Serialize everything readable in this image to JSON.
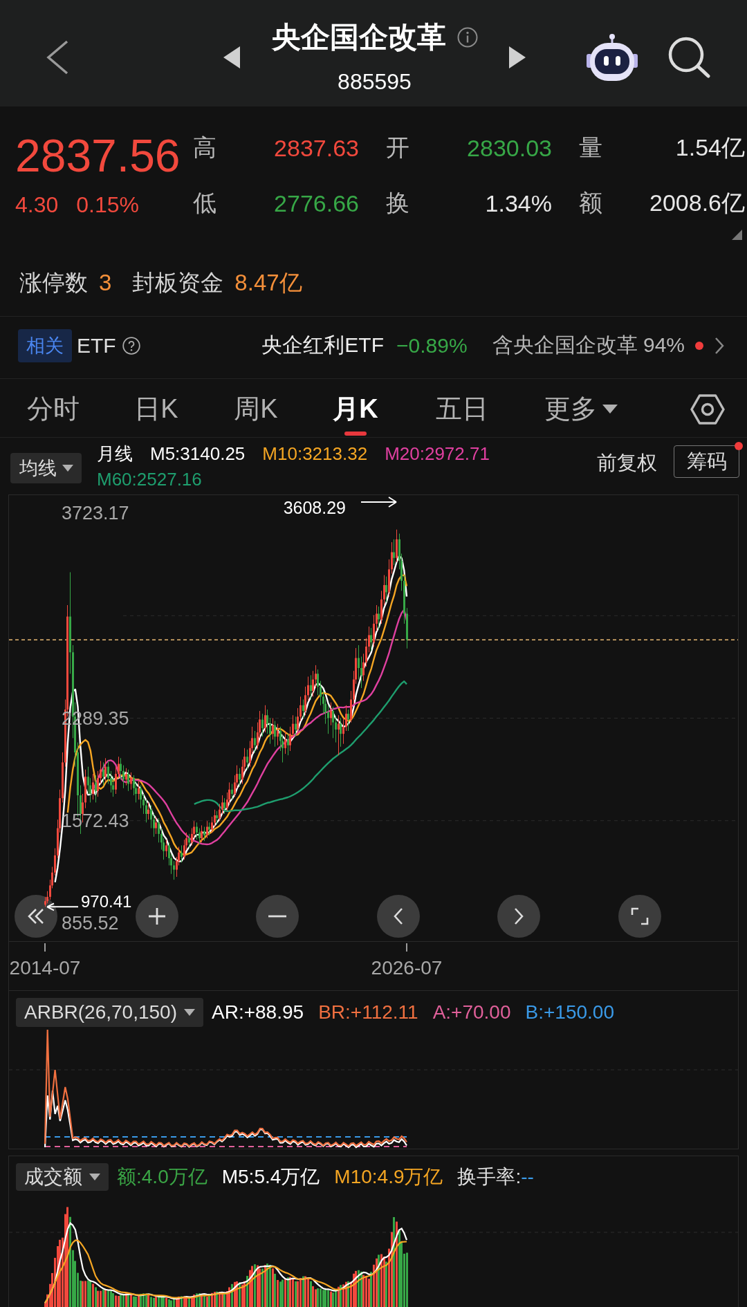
{
  "header": {
    "title": "央企国企改革",
    "code": "885595"
  },
  "quote": {
    "price": "2837.56",
    "rising": true,
    "change": "4.30",
    "change_percent": "0.15%",
    "stats": [
      {
        "label": "高",
        "value": "2837.63",
        "color": "#f2493d"
      },
      {
        "label": "开",
        "value": "2830.03",
        "color": "#37a847"
      },
      {
        "label": "量",
        "value": "1.54亿",
        "color": "#e8e8e8"
      },
      {
        "label": "低",
        "value": "2776.66",
        "color": "#37a847"
      },
      {
        "label": "换",
        "value": "1.34%",
        "color": "#e8e8e8"
      },
      {
        "label": "额",
        "value": "2008.6亿",
        "color": "#e8e8e8"
      }
    ]
  },
  "limit_up": {
    "count_label": "涨停数",
    "count": "3",
    "funds_label": "封板资金",
    "funds": "8.47亿"
  },
  "related_etf": {
    "badge": "相关",
    "label": "ETF",
    "name": "央企红利ETF",
    "change": "−0.89%",
    "rising": false,
    "holding": "含央企国企改革 94%",
    "dot": true
  },
  "tabs": [
    {
      "label": "分时",
      "selected": false,
      "kind": "plain"
    },
    {
      "label": "日K",
      "selected": false,
      "kind": "plain"
    },
    {
      "label": "周K",
      "selected": false,
      "kind": "plain"
    },
    {
      "label": "月K",
      "selected": true,
      "kind": "plain"
    },
    {
      "label": "五日",
      "selected": false,
      "kind": "plain"
    },
    {
      "label": "更多",
      "selected": false,
      "kind": "menu"
    }
  ],
  "indicator_bar": {
    "dropdown": "均线",
    "period": "月线",
    "adjust": "前复权",
    "chips": {
      "label": "筹码",
      "dot": true
    }
  },
  "price_chart": {
    "chart_data": {
      "type": "candlestick",
      "categories": [
        "2014-07",
        null,
        null,
        null,
        null,
        null,
        null,
        null,
        null,
        null,
        null,
        null,
        null,
        null,
        null,
        null,
        null,
        null,
        null,
        null,
        null,
        null,
        null,
        null,
        null,
        null,
        null,
        null,
        null,
        null,
        null,
        null,
        null,
        null,
        null,
        null,
        null,
        null,
        null,
        null,
        null,
        null,
        null,
        null,
        null,
        null,
        null,
        null,
        null,
        null,
        null,
        null,
        null,
        null,
        null,
        null,
        null,
        null,
        null,
        null,
        null,
        null,
        null,
        null,
        null,
        null,
        null,
        null,
        null,
        null,
        null,
        null,
        null,
        null,
        null,
        null,
        null,
        null,
        null,
        null,
        null,
        null,
        null,
        null,
        null,
        null,
        null,
        null,
        null,
        null,
        null,
        null,
        null,
        null,
        null,
        null,
        null,
        null,
        null,
        null,
        null,
        null,
        null,
        null,
        null,
        null,
        null,
        null,
        null,
        null,
        null,
        null,
        null,
        null,
        null,
        null,
        null,
        null,
        null,
        null,
        null,
        null,
        null,
        null,
        null,
        null,
        null,
        null,
        null,
        null,
        null,
        null,
        null,
        null,
        null,
        null,
        null,
        null,
        null,
        null,
        null,
        null,
        null,
        "2026-07"
      ],
      "ohlc": [
        [
          985,
          1040,
          970.41,
          1010
        ],
        [
          1010,
          1080,
          995,
          1040
        ],
        [
          1040,
          1160,
          1020,
          1120
        ],
        [
          1120,
          1250,
          1100,
          1210
        ],
        [
          1210,
          1380,
          1190,
          1330
        ],
        [
          1330,
          1580,
          1310,
          1520
        ],
        [
          1520,
          1790,
          1490,
          1730
        ],
        [
          1730,
          2050,
          1700,
          1980
        ],
        [
          1980,
          2420,
          1950,
          2350
        ],
        [
          2350,
          3080,
          2300,
          3000
        ],
        [
          3000,
          3310,
          2600,
          2750
        ],
        [
          2750,
          2800,
          2150,
          2300
        ],
        [
          2300,
          2400,
          1950,
          2050
        ],
        [
          2050,
          2120,
          1600,
          1750
        ],
        [
          1750,
          1820,
          1480,
          1620
        ],
        [
          1620,
          1760,
          1560,
          1700
        ],
        [
          1700,
          1930,
          1660,
          1880
        ],
        [
          1880,
          1950,
          1760,
          1820
        ],
        [
          1820,
          1870,
          1700,
          1760
        ],
        [
          1760,
          1900,
          1720,
          1840
        ],
        [
          1840,
          1890,
          1700,
          1780
        ],
        [
          1780,
          1920,
          1740,
          1870
        ],
        [
          1870,
          1990,
          1830,
          1930
        ],
        [
          1930,
          1980,
          1820,
          1880
        ],
        [
          1880,
          2010,
          1850,
          1950
        ],
        [
          1950,
          1990,
          1830,
          1870
        ],
        [
          1870,
          1920,
          1770,
          1820
        ],
        [
          1820,
          1880,
          1740,
          1790
        ],
        [
          1790,
          1950,
          1760,
          1900
        ],
        [
          1900,
          2020,
          1870,
          1970
        ],
        [
          1970,
          2010,
          1860,
          1920
        ],
        [
          1920,
          1960,
          1800,
          1860
        ],
        [
          1860,
          1940,
          1820,
          1900
        ],
        [
          1900,
          1930,
          1780,
          1830
        ],
        [
          1830,
          1910,
          1790,
          1870
        ],
        [
          1870,
          1890,
          1750,
          1800
        ],
        [
          1800,
          1840,
          1700,
          1760
        ],
        [
          1760,
          1850,
          1720,
          1800
        ],
        [
          1800,
          1820,
          1660,
          1720
        ],
        [
          1720,
          1760,
          1620,
          1680
        ],
        [
          1680,
          1720,
          1560,
          1620
        ],
        [
          1620,
          1700,
          1580,
          1650
        ],
        [
          1650,
          1680,
          1520,
          1580
        ],
        [
          1580,
          1620,
          1460,
          1520
        ],
        [
          1520,
          1600,
          1480,
          1560
        ],
        [
          1560,
          1590,
          1420,
          1480
        ],
        [
          1480,
          1520,
          1370,
          1420
        ],
        [
          1420,
          1450,
          1300,
          1360
        ],
        [
          1360,
          1440,
          1320,
          1400
        ],
        [
          1400,
          1420,
          1260,
          1310
        ],
        [
          1310,
          1340,
          1200,
          1260
        ],
        [
          1260,
          1290,
          1160,
          1230
        ],
        [
          1230,
          1320,
          1180,
          1290
        ],
        [
          1290,
          1390,
          1260,
          1350
        ],
        [
          1350,
          1400,
          1280,
          1320
        ],
        [
          1320,
          1440,
          1300,
          1400
        ],
        [
          1400,
          1490,
          1370,
          1450
        ],
        [
          1450,
          1480,
          1380,
          1420
        ],
        [
          1420,
          1520,
          1400,
          1480
        ],
        [
          1480,
          1570,
          1450,
          1530
        ],
        [
          1530,
          1560,
          1440,
          1490
        ],
        [
          1490,
          1520,
          1410,
          1450
        ],
        [
          1450,
          1540,
          1420,
          1500
        ],
        [
          1500,
          1530,
          1430,
          1470
        ],
        [
          1470,
          1570,
          1450,
          1530
        ],
        [
          1530,
          1560,
          1470,
          1510
        ],
        [
          1510,
          1600,
          1490,
          1560
        ],
        [
          1560,
          1650,
          1530,
          1610
        ],
        [
          1610,
          1640,
          1550,
          1590
        ],
        [
          1590,
          1690,
          1570,
          1650
        ],
        [
          1650,
          1750,
          1620,
          1700
        ],
        [
          1700,
          1730,
          1620,
          1660
        ],
        [
          1660,
          1770,
          1640,
          1720
        ],
        [
          1720,
          1840,
          1690,
          1790
        ],
        [
          1790,
          1830,
          1720,
          1760
        ],
        [
          1760,
          1890,
          1740,
          1840
        ],
        [
          1840,
          1960,
          1800,
          1900
        ],
        [
          1900,
          1940,
          1810,
          1860
        ],
        [
          1860,
          2000,
          1830,
          1950
        ],
        [
          1950,
          2080,
          1920,
          2020
        ],
        [
          2020,
          2070,
          1930,
          1980
        ],
        [
          1980,
          2130,
          1950,
          2080
        ],
        [
          2080,
          2230,
          2040,
          2150
        ],
        [
          2150,
          2200,
          2050,
          2100
        ],
        [
          2100,
          2260,
          2070,
          2190
        ],
        [
          2190,
          2340,
          2150,
          2280
        ],
        [
          2280,
          2320,
          2160,
          2220
        ],
        [
          2220,
          2380,
          2190,
          2310
        ],
        [
          2310,
          2350,
          2180,
          2250
        ],
        [
          2250,
          2290,
          2110,
          2180
        ],
        [
          2180,
          2290,
          2140,
          2240
        ],
        [
          2240,
          2270,
          2090,
          2160
        ],
        [
          2160,
          2250,
          2100,
          2200
        ],
        [
          2200,
          2230,
          2060,
          2130
        ],
        [
          2130,
          2170,
          1980,
          2080
        ],
        [
          2080,
          2200,
          2040,
          2140
        ],
        [
          2140,
          2180,
          2030,
          2100
        ],
        [
          2100,
          2230,
          2060,
          2180
        ],
        [
          2180,
          2310,
          2150,
          2250
        ],
        [
          2250,
          2300,
          2160,
          2210
        ],
        [
          2210,
          2360,
          2180,
          2300
        ],
        [
          2300,
          2440,
          2270,
          2380
        ],
        [
          2380,
          2420,
          2290,
          2340
        ],
        [
          2340,
          2510,
          2310,
          2450
        ],
        [
          2450,
          2580,
          2410,
          2520
        ],
        [
          2520,
          2590,
          2420,
          2480
        ],
        [
          2480,
          2620,
          2440,
          2560
        ],
        [
          2560,
          2660,
          2500,
          2600
        ],
        [
          2600,
          2630,
          2450,
          2510
        ],
        [
          2510,
          2550,
          2380,
          2440
        ],
        [
          2440,
          2480,
          2320,
          2390
        ],
        [
          2390,
          2420,
          2250,
          2330
        ],
        [
          2330,
          2380,
          2180,
          2290
        ],
        [
          2290,
          2400,
          2240,
          2340
        ],
        [
          2340,
          2370,
          2150,
          2260
        ],
        [
          2260,
          2300,
          2120,
          2210
        ],
        [
          2210,
          2310,
          2030,
          2250
        ],
        [
          2250,
          2290,
          2090,
          2180
        ],
        [
          2180,
          2290,
          2110,
          2230
        ],
        [
          2230,
          2380,
          2200,
          2320
        ],
        [
          2320,
          2350,
          2200,
          2280
        ],
        [
          2280,
          2480,
          2260,
          2420
        ],
        [
          2420,
          2620,
          2390,
          2560
        ],
        [
          2560,
          2780,
          2530,
          2710
        ],
        [
          2710,
          2800,
          2560,
          2640
        ],
        [
          2640,
          2720,
          2500,
          2590
        ],
        [
          2590,
          2740,
          2550,
          2680
        ],
        [
          2680,
          2850,
          2650,
          2790
        ],
        [
          2790,
          2930,
          2750,
          2870
        ],
        [
          2870,
          2920,
          2760,
          2820
        ],
        [
          2820,
          3010,
          2790,
          2950
        ],
        [
          2950,
          3080,
          2900,
          3020
        ],
        [
          3020,
          3070,
          2910,
          2980
        ],
        [
          2980,
          3180,
          2950,
          3120
        ],
        [
          3120,
          3290,
          3080,
          3220
        ],
        [
          3220,
          3280,
          3100,
          3170
        ],
        [
          3170,
          3400,
          3140,
          3330
        ],
        [
          3330,
          3520,
          3300,
          3450
        ],
        [
          3450,
          3540,
          3360,
          3410
        ],
        [
          3410,
          3608.29,
          3380,
          3540
        ],
        [
          3540,
          3580,
          3330,
          3390
        ],
        [
          3390,
          3440,
          3180,
          3250
        ],
        [
          3250,
          3290,
          2950,
          3020
        ],
        [
          3020,
          3060,
          2776.66,
          2837.56
        ]
      ],
      "series": [
        {
          "name": "M5:3140.25",
          "type": "line",
          "color": "#ffffff",
          "values": [
            null,
            null,
            null,
            null,
            1142,
            1244,
            1382,
            1554,
            1782,
            2116,
            2362,
            2476,
            2490,
            2370,
            2094,
            1884,
            1800,
            1754,
            1756,
            1800,
            1755,
            1814,
            1836,
            1860,
            1882,
            1900,
            1890,
            1862,
            1866,
            1870,
            1880,
            1888,
            1910,
            1896,
            1876,
            1852,
            1832,
            1812,
            1790,
            1752,
            1716,
            1694,
            1650,
            1610,
            1586,
            1558,
            1512,
            1468,
            1444,
            1394,
            1350,
            1312,
            1298,
            1288,
            1290,
            1318,
            1362,
            1388,
            1414,
            1456,
            1474,
            1474,
            1490,
            1488,
            1488,
            1492,
            1514,
            1536,
            1560,
            1584,
            1622,
            1642,
            1664,
            1704,
            1726,
            1754,
            1802,
            1830,
            1862,
            1914,
            1942,
            1978,
            2036,
            2066,
            2100,
            2160,
            2188,
            2220,
            2250,
            2248,
            2240,
            2228,
            2206,
            2182,
            2162,
            2142,
            2130,
            2126,
            2150,
            2176,
            2208,
            2264,
            2296,
            2336,
            2398,
            2434,
            2470,
            2522,
            2534,
            2518,
            2500,
            2454,
            2392,
            2358,
            2322,
            2286,
            2270,
            2248,
            2226,
            2238,
            2252,
            2286,
            2362,
            2458,
            2522,
            2584,
            2636,
            2682,
            2714,
            2750,
            2822,
            2890,
            2928,
            2978,
            3058,
            3102,
            3164,
            3258,
            3316,
            3380,
            3424,
            3408,
            3322,
            3140
          ]
        },
        {
          "name": "M10:3213.32",
          "type": "line",
          "color": "#f5a623",
          "values": [
            null,
            null,
            null,
            null,
            null,
            null,
            null,
            null,
            null,
            1629,
            1803,
            1929,
            2022,
            2076,
            2105,
            2123,
            2138,
            2122,
            2063,
            1947,
            1850,
            1807,
            1795,
            1808,
            1841,
            1858,
            1852,
            1849,
            1863,
            1876,
            1890,
            1889,
            1886,
            1881,
            1873,
            1866,
            1860,
            1861,
            1843,
            1814,
            1784,
            1763,
            1731,
            1700,
            1669,
            1637,
            1603,
            1559,
            1527,
            1490,
            1454,
            1412,
            1383,
            1366,
            1342,
            1334,
            1337,
            1343,
            1351,
            1373,
            1396,
            1418,
            1439,
            1451,
            1472,
            1483,
            1494,
            1513,
            1524,
            1536,
            1557,
            1578,
            1600,
            1632,
            1655,
            1688,
            1722,
            1747,
            1783,
            1820,
            1848,
            1890,
            1933,
            1964,
            2007,
            2051,
            2083,
            2128,
            2158,
            2174,
            2200,
            2208,
            2213,
            2216,
            2205,
            2191,
            2179,
            2166,
            2166,
            2169,
            2175,
            2197,
            2211,
            2243,
            2287,
            2321,
            2367,
            2409,
            2435,
            2458,
            2467,
            2462,
            2457,
            2446,
            2420,
            2393,
            2362,
            2320,
            2292,
            2280,
            2269,
            2278,
            2305,
            2342,
            2380,
            2418,
            2461,
            2522,
            2586,
            2636,
            2703,
            2763,
            2805,
            2846,
            2904,
            2962,
            3027,
            3093,
            3147,
            3219,
            3263,
            3286,
            3290,
            3213
          ]
        },
        {
          "name": "M20:2972.71",
          "type": "line",
          "color": "#e040a0",
          "values": [
            null,
            null,
            null,
            null,
            null,
            null,
            null,
            null,
            null,
            null,
            null,
            null,
            null,
            null,
            null,
            null,
            null,
            null,
            null,
            1788,
            1827,
            1868,
            1909,
            1942,
            1973,
            1991,
            1995,
            1986,
            1963,
            1912,
            1870,
            1848,
            1841,
            1845,
            1857,
            1862,
            1856,
            1855,
            1853,
            1845,
            1837,
            1826,
            1809,
            1791,
            1771,
            1752,
            1732,
            1710,
            1685,
            1652,
            1619,
            1588,
            1557,
            1533,
            1506,
            1486,
            1470,
            1451,
            1439,
            1432,
            1425,
            1415,
            1411,
            1409,
            1407,
            1409,
            1416,
            1428,
            1438,
            1455,
            1477,
            1498,
            1520,
            1542,
            1564,
            1586,
            1608,
            1630,
            1654,
            1678,
            1703,
            1734,
            1767,
            1798,
            1831,
            1870,
            1903,
            1938,
            1971,
            1997,
            2024,
            2049,
            2073,
            2090,
            2106,
            2121,
            2131,
            2147,
            2162,
            2172,
            2188,
            2203,
            2212,
            2230,
            2246,
            2256,
            2273,
            2288,
            2301,
            2314,
            2321,
            2330,
            2334,
            2345,
            2354,
            2357,
            2365,
            2365,
            2364,
            2369,
            2368,
            2370,
            2381,
            2394,
            2400,
            2406,
            2412,
            2421,
            2439,
            2458,
            2486,
            2521,
            2555,
            2594,
            2642,
            2690,
            2744,
            2808,
            2867,
            2928,
            2983,
            3025,
            3048,
            2973
          ]
        },
        {
          "name": "M60:2527.16",
          "type": "line",
          "color": "#1e9e6e",
          "values": [
            null,
            null,
            null,
            null,
            null,
            null,
            null,
            null,
            null,
            null,
            null,
            null,
            null,
            null,
            null,
            null,
            null,
            null,
            null,
            null,
            null,
            null,
            null,
            null,
            null,
            null,
            null,
            null,
            null,
            null,
            null,
            null,
            null,
            null,
            null,
            null,
            null,
            null,
            null,
            null,
            null,
            null,
            null,
            null,
            null,
            null,
            null,
            null,
            null,
            null,
            null,
            null,
            null,
            null,
            null,
            null,
            null,
            null,
            null,
            1688,
            1696,
            1703,
            1710,
            1714,
            1717,
            1717,
            1714,
            1708,
            1695,
            1673,
            1655,
            1645,
            1639,
            1640,
            1642,
            1645,
            1645,
            1645,
            1649,
            1652,
            1655,
            1658,
            1662,
            1666,
            1670,
            1677,
            1684,
            1692,
            1698,
            1701,
            1707,
            1712,
            1717,
            1722,
            1725,
            1731,
            1736,
            1743,
            1752,
            1761,
            1772,
            1784,
            1797,
            1812,
            1828,
            1845,
            1864,
            1885,
            1903,
            1922,
            1941,
            1959,
            1976,
            1992,
            2008,
            2021,
            2035,
            2047,
            2060,
            2073,
            2086,
            2102,
            2120,
            2141,
            2159,
            2177,
            2196,
            2216,
            2237,
            2256,
            2277,
            2300,
            2321,
            2343,
            2367,
            2389,
            2413,
            2440,
            2464,
            2490,
            2513,
            2533,
            2547,
            2527
          ]
        }
      ],
      "ylim": [
        730,
        3849
      ],
      "yticks": [
        {
          "value": 3723.17,
          "label": "3723.17"
        },
        {
          "value": 2289.35,
          "label": "2289.35"
        },
        {
          "value": 1572.43,
          "label": "1572.43"
        },
        {
          "value": 855.52,
          "label": "855.52"
        }
      ],
      "ref_lines": [
        {
          "axis": "y",
          "value": 2837.56,
          "color": "#e8b872"
        }
      ]
    },
    "high_marker": "3608.29",
    "low_marker": "970.41"
  },
  "arbr": {
    "dropdown": "ARBR(26,70,150)",
    "values": [
      {
        "text": "AR:+88.95",
        "color": "#ffffff"
      },
      {
        "text": "BR:+112.11",
        "color": "#f07040"
      },
      {
        "text": "A:+70.00",
        "color": "#e0609a"
      },
      {
        "text": "B:+150.00",
        "color": "#3a9ae8"
      }
    ]
  },
  "turnover": {
    "dropdown": "成交额",
    "values": [
      {
        "text": "额:4.0万亿",
        "color": "#3aa545"
      },
      {
        "text": "M5:5.4万亿",
        "color": "#ffffff"
      },
      {
        "text": "M10:4.9万亿",
        "color": "#f5a623"
      },
      {
        "label": "换手率:",
        "text": "--",
        "color": "#3a9ae8"
      }
    ]
  }
}
